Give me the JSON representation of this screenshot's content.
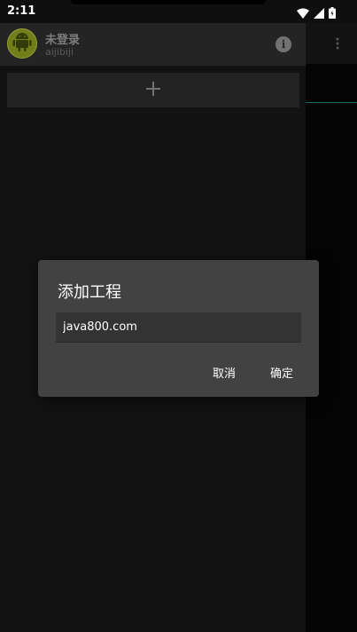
{
  "status_bar": {
    "time": "2:11"
  },
  "drawer": {
    "user_name": "未登录",
    "user_subtitle": "aijibiji",
    "add_symbol": "+"
  },
  "dialog": {
    "title": "添加工程",
    "input_value": "java800.com",
    "cancel_label": "取消",
    "confirm_label": "确定"
  },
  "colors": {
    "drawer_bg": "#161616",
    "header_bg": "#2c2c2c",
    "dialog_bg": "#424242",
    "avatar_bg": "#8a9a1f"
  },
  "icons": [
    "wifi-icon",
    "signal-icon",
    "battery-icon",
    "android-icon",
    "info-icon",
    "plus-icon",
    "more-vert-icon"
  ]
}
